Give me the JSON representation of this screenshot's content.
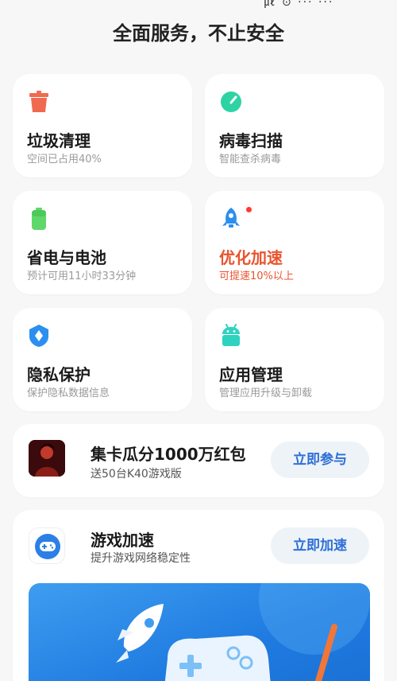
{
  "status": {
    "fragment": "㎕ ⊙ ··· ··· ⁀"
  },
  "header": {
    "title": "全面服务，不止安全"
  },
  "tiles": [
    {
      "title": "垃圾清理",
      "subtitle": "空间已占用40%",
      "icon": "trash-icon",
      "color": "#f06a4f"
    },
    {
      "title": "病毒扫描",
      "subtitle": "智能查杀病毒",
      "icon": "gauge-icon",
      "color": "#2ed3a4"
    },
    {
      "title": "省电与电池",
      "subtitle": "预计可用11小时33分钟",
      "icon": "battery-icon",
      "color": "#5fd86a"
    },
    {
      "title": "优化加速",
      "subtitle": "可提速10%以上",
      "icon": "rocket-icon",
      "color": "#2b8ff0",
      "accent": "#e8542e"
    },
    {
      "title": "隐私保护",
      "subtitle": "保护隐私数据信息",
      "icon": "shield-icon",
      "color": "#2b8ff0"
    },
    {
      "title": "应用管理",
      "subtitle": "管理应用升级与卸载",
      "icon": "android-icon",
      "color": "#2ed3c0"
    }
  ],
  "promo": {
    "title": "集卡瓜分1000万红包",
    "subtitle": "送50台K40游戏版",
    "button": "立即参与"
  },
  "game": {
    "title": "游戏加速",
    "subtitle": "提升游戏网络稳定性",
    "button": "立即加速"
  }
}
